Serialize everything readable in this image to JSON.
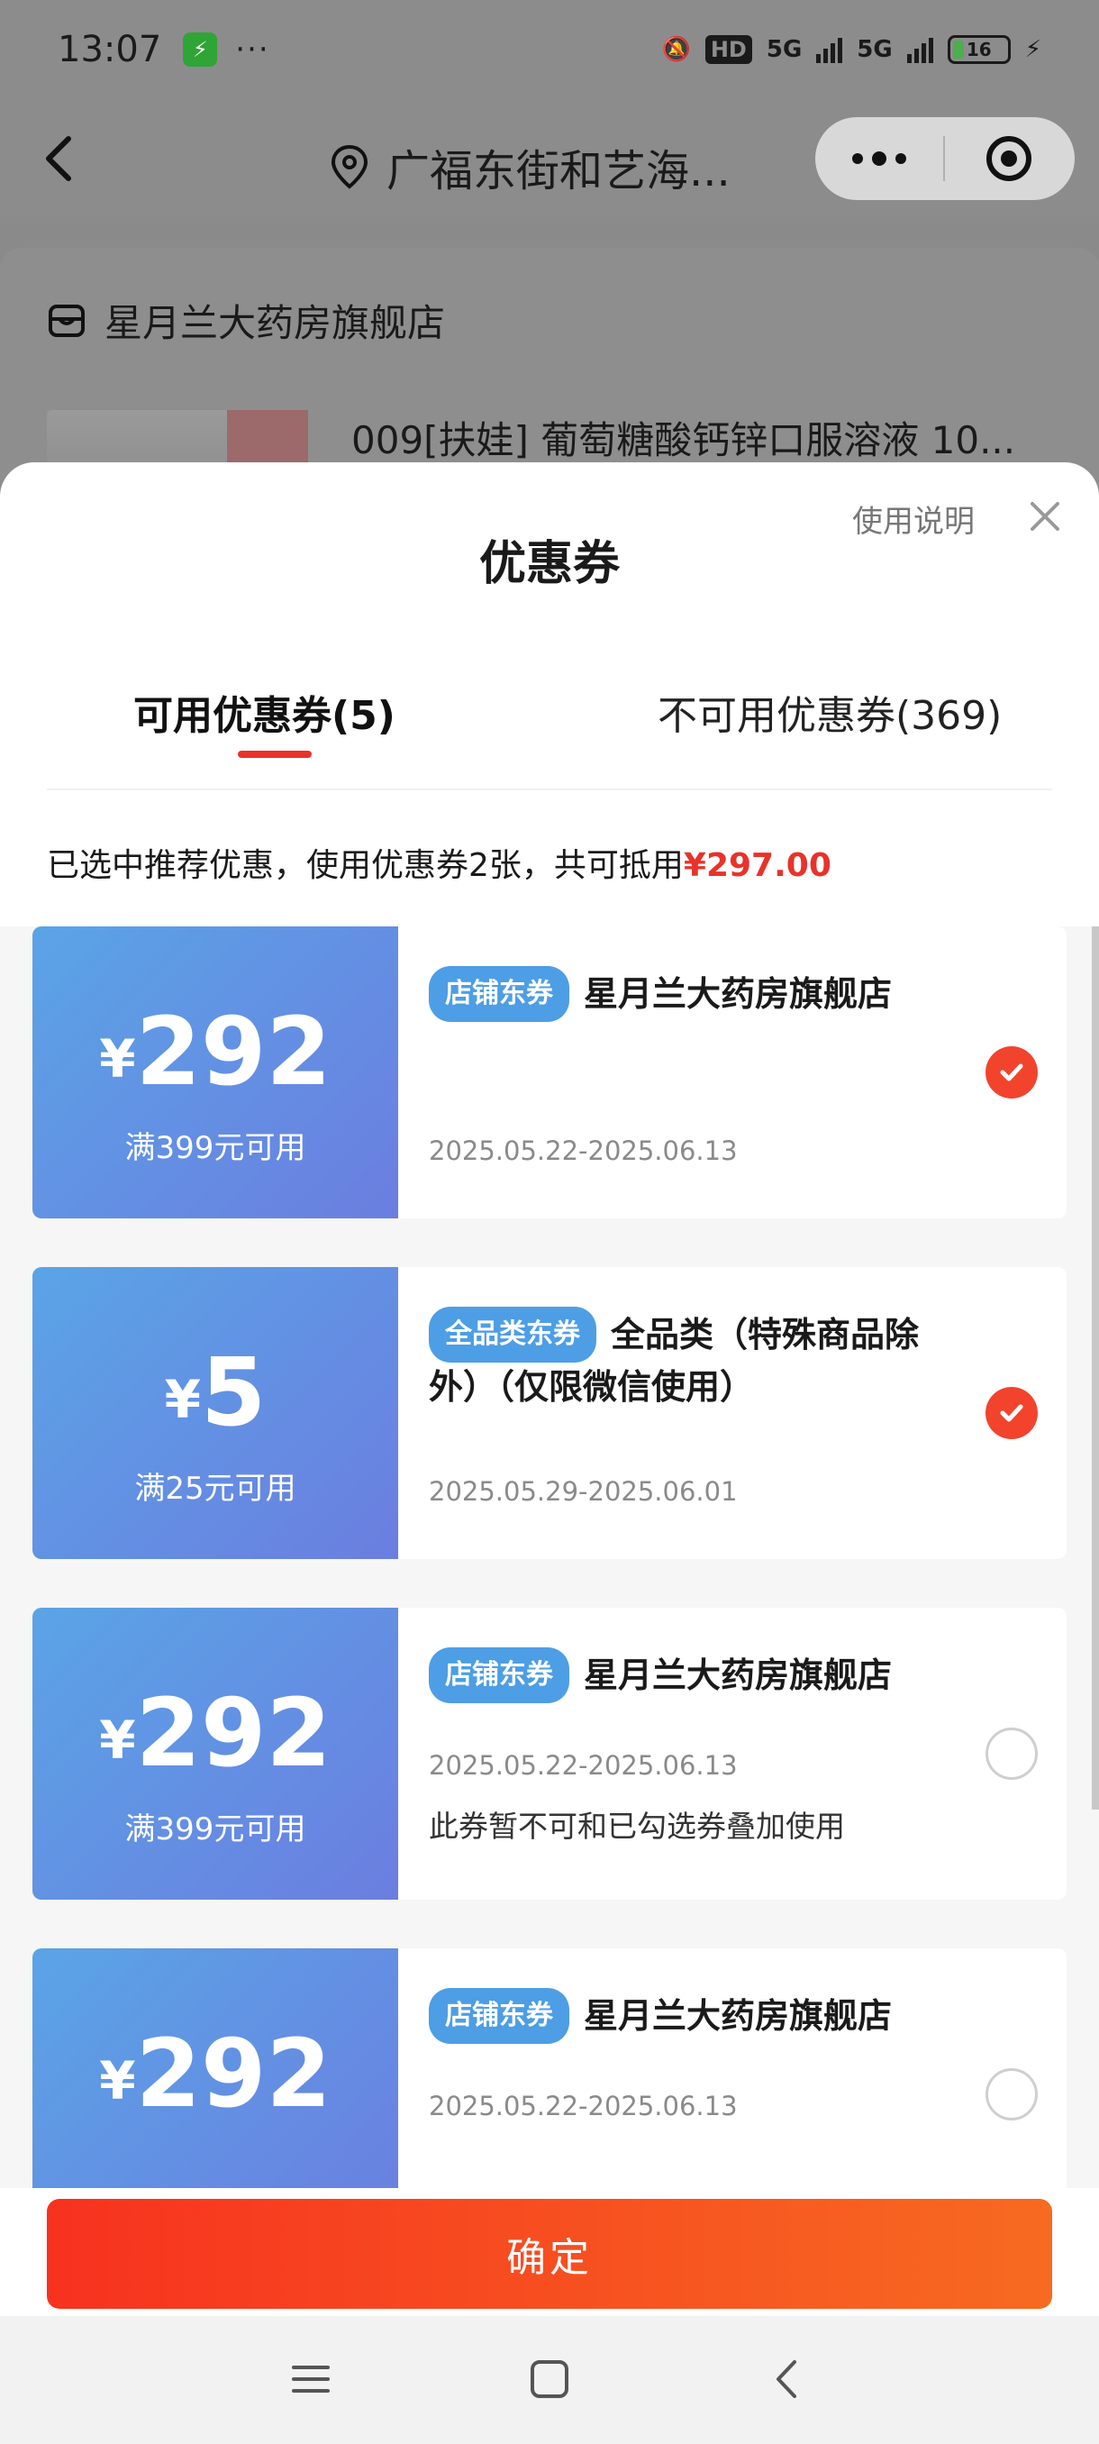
{
  "status_bar": {
    "time": "13:07",
    "dots": "···",
    "hd": "HD",
    "network": "5G",
    "battery": "16"
  },
  "nav": {
    "location": "广福东街和艺海..."
  },
  "background": {
    "store_name": "星月兰大药房旗舰店",
    "product_name": "009[扶娃] 葡萄糖酸钙锌口服溶液 10..."
  },
  "sheet": {
    "title": "优惠券",
    "usage_link": "使用说明",
    "tabs": [
      {
        "label": "可用优惠券(5)",
        "active": true
      },
      {
        "label": "不可用优惠券(369)",
        "active": false
      }
    ],
    "summary_text": "已选中推荐优惠，使用优惠券2张，共可抵用",
    "summary_amount": "¥297.00"
  },
  "coupons": [
    {
      "currency": "¥",
      "amount": "292",
      "threshold": "满399元可用",
      "tag": "店铺东券",
      "name": "星月兰大药房旗舰店",
      "date": "2025.05.22-2025.06.13",
      "note": "",
      "selected": true
    },
    {
      "currency": "¥",
      "amount": "5",
      "threshold": "满25元可用",
      "tag": "全品类东券",
      "name": "全品类（特殊商品除外）（仅限微信使用）",
      "date": "2025.05.29-2025.06.01",
      "note": "",
      "selected": true
    },
    {
      "currency": "¥",
      "amount": "292",
      "threshold": "满399元可用",
      "tag": "店铺东券",
      "name": "星月兰大药房旗舰店",
      "date": "2025.05.22-2025.06.13",
      "note": "此券暂不可和已勾选券叠加使用",
      "selected": false
    },
    {
      "currency": "¥",
      "amount": "292",
      "threshold": "",
      "tag": "店铺东券",
      "name": "星月兰大药房旗舰店",
      "date": "2025.05.22-2025.06.13",
      "note": "",
      "selected": false
    }
  ],
  "confirm_label": "确定",
  "colors": {
    "accent_red": "#f2442d",
    "coupon_gradient_start": "#5aa4e6",
    "coupon_gradient_end": "#6b7ee0",
    "tag_blue": "#4d9ee4"
  }
}
